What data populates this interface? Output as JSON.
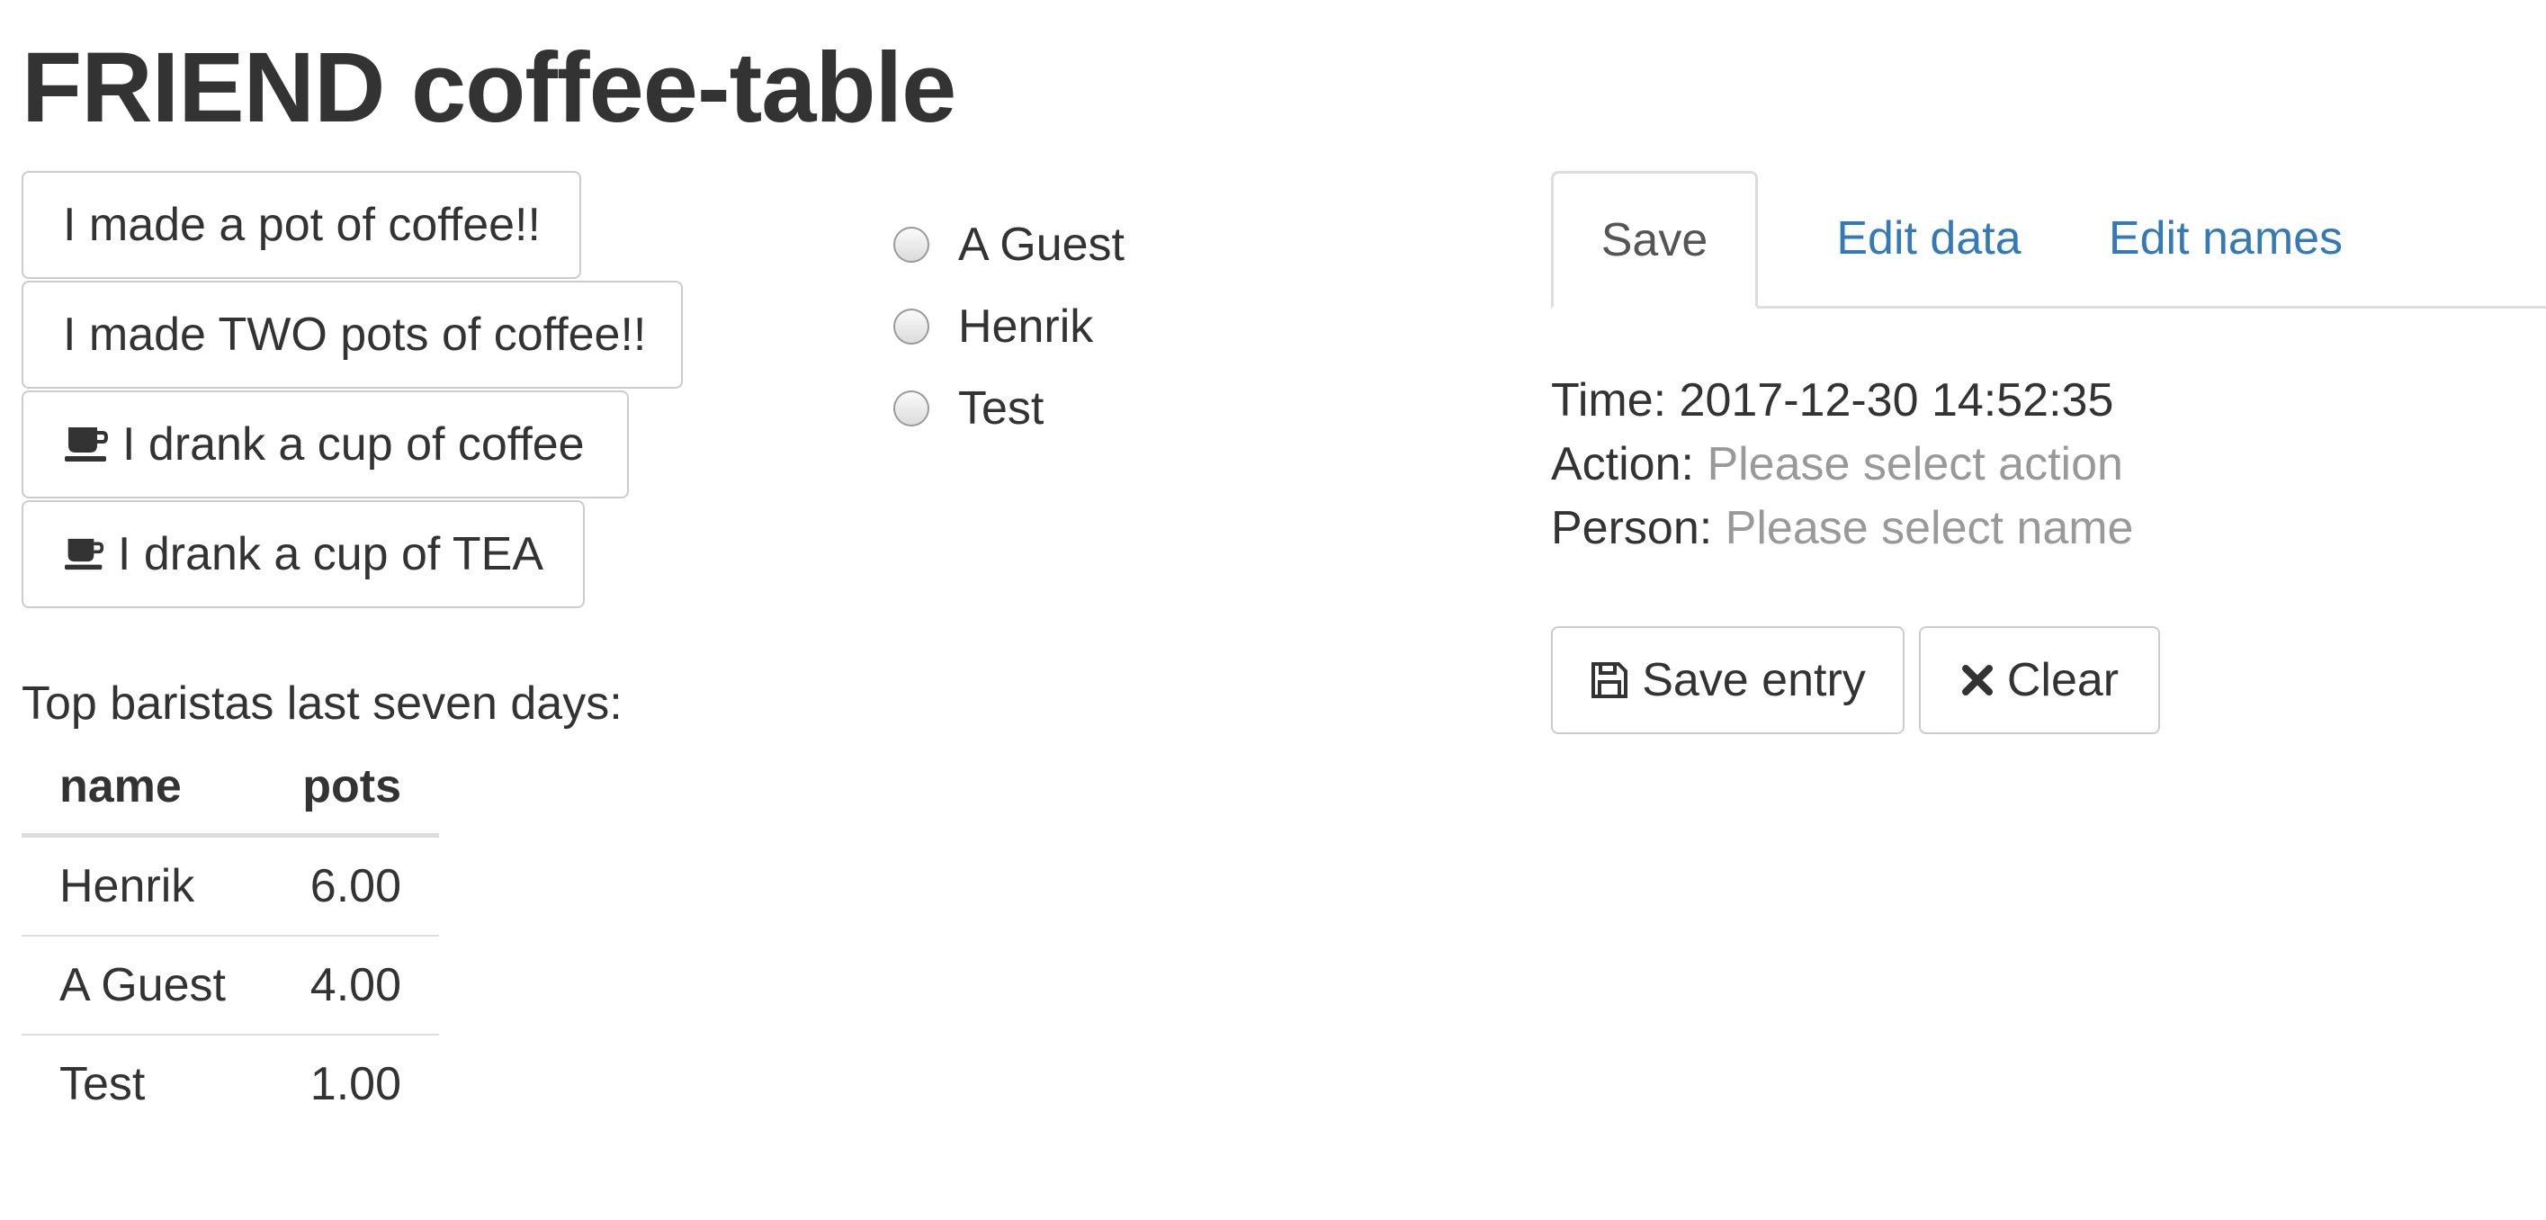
{
  "page": {
    "title": "FRIEND coffee-table"
  },
  "actions": {
    "pot_one": "I made a pot of coffee!!",
    "pot_two": "I made TWO pots of coffee!!",
    "cup_coffee": "I drank a cup of coffee",
    "cup_tea": "I drank a cup of TEA"
  },
  "icons": {
    "cup": "coffee-cup-icon",
    "save": "floppy-disk-icon",
    "clear": "x-mark-icon"
  },
  "baristas": {
    "label": "Top baristas last seven days:",
    "columns": [
      "name",
      "pots"
    ],
    "rows": [
      {
        "name": "Henrik",
        "pots": "6.00"
      },
      {
        "name": "A Guest",
        "pots": "4.00"
      },
      {
        "name": "Test",
        "pots": "1.00"
      }
    ]
  },
  "people": {
    "options": [
      "A Guest",
      "Henrik",
      "Test"
    ]
  },
  "tabs": [
    {
      "label": "Save",
      "active": true
    },
    {
      "label": "Edit data",
      "active": false
    },
    {
      "label": "Edit names",
      "active": false
    }
  ],
  "entry": {
    "time_label": "Time:",
    "time_value": "2017-12-30 14:52:35",
    "action_label": "Action:",
    "action_placeholder": "Please select action",
    "person_label": "Person:",
    "person_placeholder": "Please select name",
    "save_label": "Save entry",
    "clear_label": "Clear"
  },
  "colors": {
    "text": "#333333",
    "link": "#337ab7",
    "muted": "#999999",
    "border": "#cccccc"
  }
}
